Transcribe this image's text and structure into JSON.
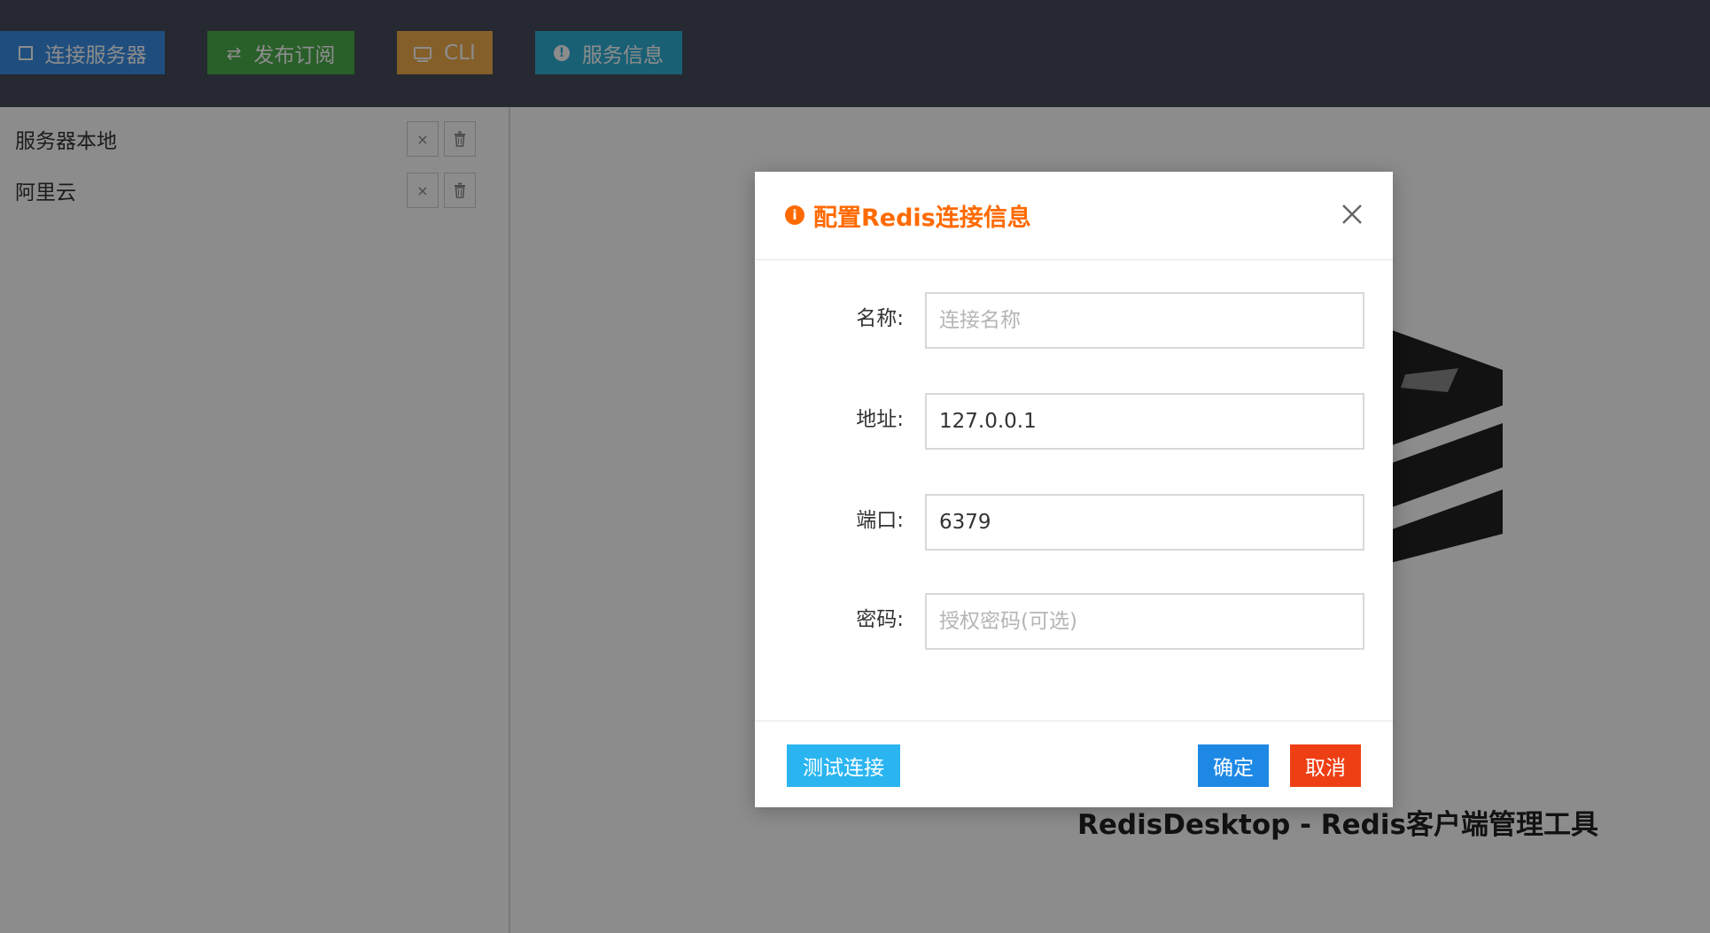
{
  "toolbar": {
    "connect_label": "连接服务器",
    "pubsub_label": "发布订阅",
    "cli_label": "CLI",
    "info_label": "服务信息"
  },
  "sidebar": {
    "servers": [
      {
        "name": "服务器本地",
        "close_icon": "×"
      },
      {
        "name": "阿里云",
        "close_icon": "×"
      }
    ]
  },
  "main": {
    "brand_title": "RedisDesktop - Redis客户端管理工具"
  },
  "dialog": {
    "title": "配置Redis连接信息",
    "title_icon": "i",
    "fields": {
      "name": {
        "label": "名称:",
        "value": "",
        "placeholder": "连接名称"
      },
      "address": {
        "label": "地址:",
        "value": "127.0.0.1",
        "placeholder": ""
      },
      "port": {
        "label": "端口:",
        "value": "6379",
        "placeholder": ""
      },
      "password": {
        "label": "密码:",
        "value": "",
        "placeholder": "授权密码(可选)"
      }
    },
    "buttons": {
      "test": "测试连接",
      "ok": "确定",
      "cancel": "取消"
    }
  },
  "colors": {
    "toolbar_bg": "#464c59",
    "connect": "#3a8ee6",
    "pubsub": "#4cae4c",
    "cli": "#f0ad4e",
    "info": "#31b0d5",
    "dialog_title": "#ff6a00",
    "test_button": "#2bb5f0",
    "ok_button": "#1e88e5",
    "cancel_button": "#ee3f14"
  }
}
